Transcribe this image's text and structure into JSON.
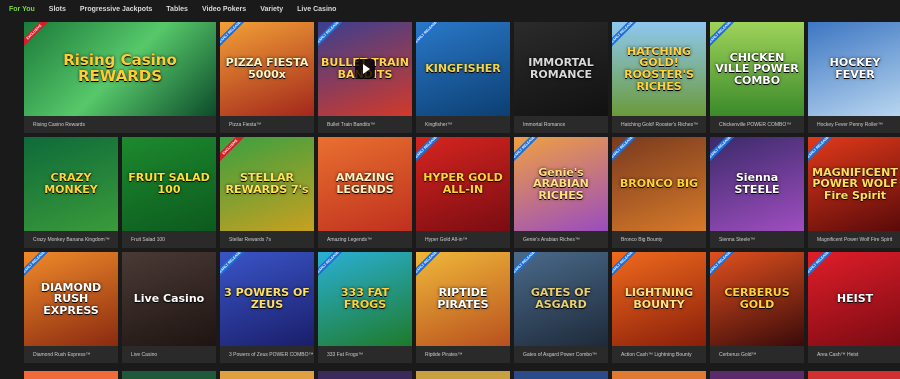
{
  "nav": {
    "items": [
      {
        "label": "For You",
        "active": true
      },
      {
        "label": "Slots",
        "active": false
      },
      {
        "label": "Progressive Jackpots",
        "active": false
      },
      {
        "label": "Tables",
        "active": false
      },
      {
        "label": "Video Pokers",
        "active": false
      },
      {
        "label": "Variety",
        "active": false
      },
      {
        "label": "Live Casino",
        "active": false
      }
    ]
  },
  "badges": {
    "early": "EARLY RELEASE",
    "exclusive": "EXCLUSIVE"
  },
  "games": [
    {
      "caption": "Rising Casino Rewards",
      "art": "Rising Casino REWARDS",
      "bg": "linear-gradient(135deg,#1b7a3a,#57c86a 50%,#0c4b2a)",
      "color": "#ffcc33",
      "badge": "exclusive",
      "wide": true
    },
    {
      "caption": "Pizza Fiesta™",
      "art": "PIZZA FIESTA 5000x",
      "bg": "linear-gradient(160deg,#f2a037,#a3271b)",
      "color": "#fff4c4",
      "badge": "early"
    },
    {
      "caption": "Bullet Train Bandits™",
      "art": "BULLET TRAIN BANDITS",
      "bg": "linear-gradient(160deg,#3b3f8f,#d23a2a)",
      "color": "#ffd54a",
      "badge": "early",
      "play": true
    },
    {
      "caption": "Kingfisher™",
      "art": "KINGFISHER",
      "bg": "linear-gradient(160deg,#2a78c8,#0c3f73)",
      "color": "#f5d640",
      "badge": "early"
    },
    {
      "caption": "Immortal Romance",
      "art": "IMMORTAL ROMANCE",
      "bg": "linear-gradient(160deg,#2b2b2b,#111)",
      "color": "#d9d9d9",
      "badge": ""
    },
    {
      "caption": "Hatching Gold! Rooster's Riches™",
      "art": "HATCHING GOLD! ROOSTER'S RICHES",
      "bg": "linear-gradient(180deg,#8ec8f0,#6b9a3a)",
      "color": "#ffd23a",
      "badge": "early"
    },
    {
      "caption": "Chickenville POWER COMBO™",
      "art": "CHICKEN VILLE POWER COMBO",
      "bg": "linear-gradient(180deg,#9fd35a,#3b8a2a)",
      "color": "#fff",
      "badge": "early"
    },
    {
      "caption": "Hockey Fever Penny Roller™",
      "art": "HOCKEY FEVER",
      "bg": "linear-gradient(160deg,#3d76c2,#b8d6f0)",
      "color": "#fff",
      "badge": ""
    },
    {
      "caption": "Crazy Monkey Banana Kingdom™",
      "art": "CRAZY MONKEY",
      "bg": "linear-gradient(160deg,#0e6a3a,#3a9b3a)",
      "color": "#ffd23a",
      "badge": ""
    },
    {
      "caption": "Fruit Salad 100",
      "art": "FRUIT SALAD 100",
      "bg": "linear-gradient(160deg,#1d8a2e,#0c5a1e)",
      "color": "#ffdc3a",
      "badge": ""
    },
    {
      "caption": "Stellar Rewards 7s",
      "art": "STELLAR REWARDS 7's",
      "bg": "linear-gradient(160deg,#3aa040,#c8a020)",
      "color": "#ffe15a",
      "badge": "exclusive"
    },
    {
      "caption": "Amazing Legends™",
      "art": "AMAZING LEGENDS",
      "bg": "linear-gradient(160deg,#e87030,#c0301e)",
      "color": "#fff2c0",
      "badge": ""
    },
    {
      "caption": "Hyper Gold All-in™",
      "art": "HYPER GOLD ALL-IN",
      "bg": "linear-gradient(160deg,#d6251f,#7a0c12)",
      "color": "#ffd23a",
      "badge": "early"
    },
    {
      "caption": "Genie's Arabian Riches™",
      "art": "Genie's ARABIAN RICHES",
      "bg": "linear-gradient(160deg,#f0a040,#9a4cc0)",
      "color": "#ffe080",
      "badge": "early"
    },
    {
      "caption": "Bronco Big Bounty",
      "art": "BRONCO BIG",
      "bg": "linear-gradient(160deg,#7a3a1e,#d67a2a)",
      "color": "#ffd23a",
      "badge": "early"
    },
    {
      "caption": "Sienna Steele™",
      "art": "Sienna STEELE",
      "bg": "linear-gradient(160deg,#3a2a6a,#a04ec0)",
      "color": "#fff",
      "badge": "early"
    },
    {
      "caption": "Magnificent Power Wolf Fire Spirit",
      "art": "MAGNIFICENT POWER WOLF Fire Spirit",
      "bg": "linear-gradient(160deg,#e03a1a,#5a0a0a)",
      "color": "#ffe060",
      "badge": "early"
    },
    {
      "caption": "Diamond Rush Express™",
      "art": "DIAMOND RUSH EXPRESS",
      "bg": "linear-gradient(160deg,#f08a2a,#8a2a10)",
      "color": "#fff",
      "badge": "early"
    },
    {
      "caption": "Live Casino",
      "art": "Live Casino",
      "bg": "linear-gradient(160deg,#4a3a35,#1e1412)",
      "color": "#fff",
      "badge": ""
    },
    {
      "caption": "3 Powers of Zeus POWER COMBO™",
      "art": "3 POWERS OF ZEUS",
      "bg": "linear-gradient(160deg,#3a55c8,#1a1e6a)",
      "color": "#ffe060",
      "badge": "early"
    },
    {
      "caption": "333 Fat Frogs™",
      "art": "333 FAT FROGS",
      "bg": "linear-gradient(160deg,#2ab0d6,#1e7a2a)",
      "color": "#ffd23a",
      "badge": "early"
    },
    {
      "caption": "Riptide Pirates™",
      "art": "RIPTIDE PIRATES",
      "bg": "linear-gradient(160deg,#f0b83a,#b8501e)",
      "color": "#fff",
      "badge": "early"
    },
    {
      "caption": "Gates of Asgard Power Combo™",
      "art": "GATES OF ASGARD",
      "bg": "linear-gradient(160deg,#4a6a8a,#1e2a3a)",
      "color": "#e8d070",
      "badge": "early"
    },
    {
      "caption": "Action Cash™ Lightning Bounty",
      "art": "LIGHTNING BOUNTY",
      "bg": "linear-gradient(160deg,#f06a1e,#8a1e0a)",
      "color": "#ffe080",
      "badge": "early"
    },
    {
      "caption": "Cerberus Gold™",
      "art": "CERBERUS GOLD",
      "bg": "linear-gradient(160deg,#e0501e,#3a0a0a)",
      "color": "#ffd23a",
      "badge": "early"
    },
    {
      "caption": "Area Cash™ Heist",
      "art": "HEIST",
      "bg": "linear-gradient(160deg,#e01e2a,#7a0a12)",
      "color": "#fff",
      "badge": "early"
    }
  ],
  "row4": [
    "#f06a3a",
    "#1e5a3a",
    "#e0a040",
    "#3a2a5a",
    "#c8a040",
    "#2a4a8a",
    "#e07a30",
    "#5a2a6a",
    "#d03030"
  ],
  "colors": {
    "accent": "#7cd63a",
    "background": "#1a1a1a",
    "caption_bg": "#2a2a2a"
  }
}
